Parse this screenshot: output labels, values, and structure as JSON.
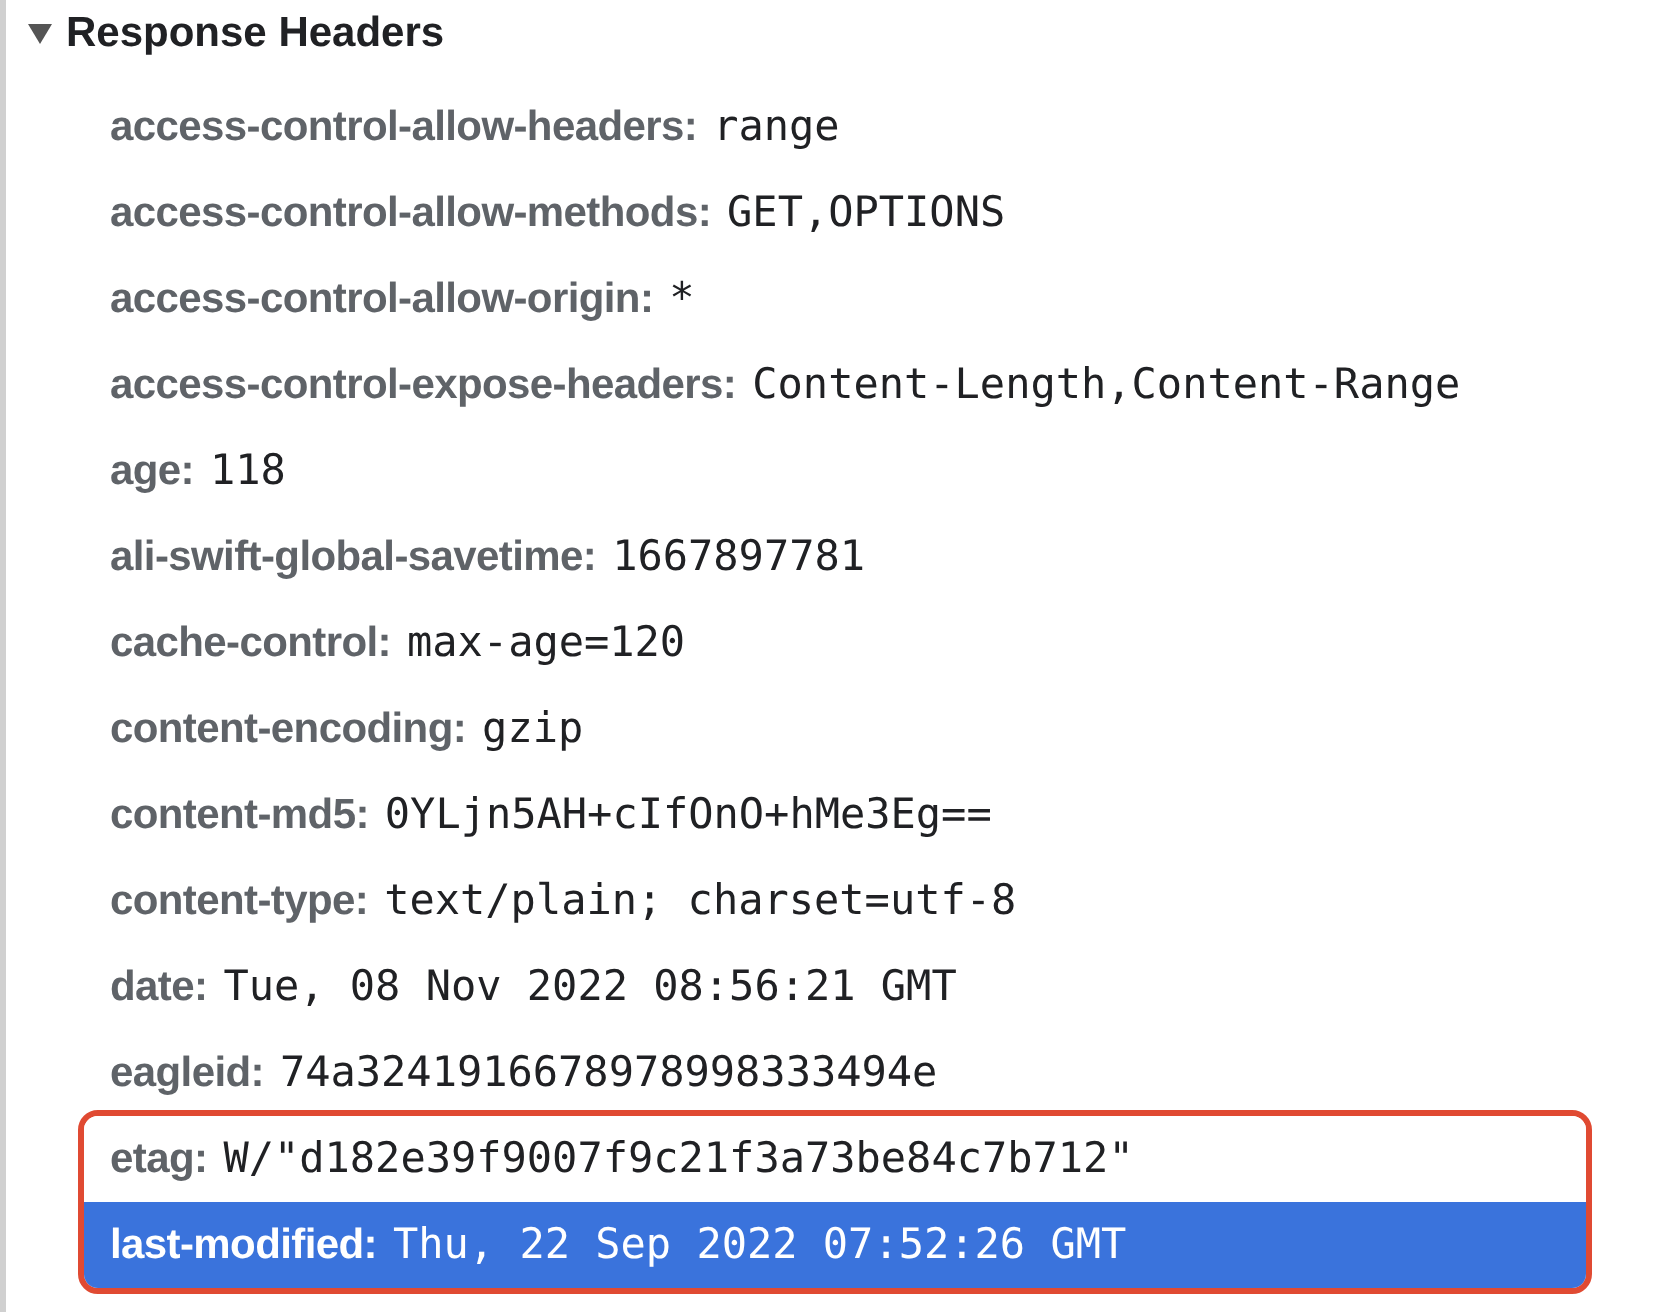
{
  "section": {
    "title": "Response Headers",
    "expanded": true,
    "headers": [
      {
        "name": "access-control-allow-headers:",
        "value": "range",
        "selected": false,
        "annotated": false
      },
      {
        "name": "access-control-allow-methods:",
        "value": "GET,OPTIONS",
        "selected": false,
        "annotated": false
      },
      {
        "name": "access-control-allow-origin:",
        "value": "*",
        "selected": false,
        "annotated": false
      },
      {
        "name": "access-control-expose-headers:",
        "value": "Content-Length,Content-Range",
        "selected": false,
        "annotated": false
      },
      {
        "name": "age:",
        "value": "118",
        "selected": false,
        "annotated": false
      },
      {
        "name": "ali-swift-global-savetime:",
        "value": "1667897781",
        "selected": false,
        "annotated": false
      },
      {
        "name": "cache-control:",
        "value": "max-age=120",
        "selected": false,
        "annotated": false
      },
      {
        "name": "content-encoding:",
        "value": "gzip",
        "selected": false,
        "annotated": false
      },
      {
        "name": "content-md5:",
        "value": "0YLjn5AH+cIfOnO+hMe3Eg==",
        "selected": false,
        "annotated": false
      },
      {
        "name": "content-type:",
        "value": "text/plain; charset=utf-8",
        "selected": false,
        "annotated": false
      },
      {
        "name": "date:",
        "value": "Tue, 08 Nov 2022 08:56:21 GMT",
        "selected": false,
        "annotated": false
      },
      {
        "name": "eagleid:",
        "value": "74a3241916678978998333494e",
        "selected": false,
        "annotated": false
      },
      {
        "name": "etag:",
        "value": "W/\"d182e39f9007f9c21f3a73be84c7b712\"",
        "selected": false,
        "annotated": true
      },
      {
        "name": "last-modified:",
        "value": "Thu, 22 Sep 2022 07:52:26 GMT",
        "selected": true,
        "annotated": true
      }
    ]
  }
}
